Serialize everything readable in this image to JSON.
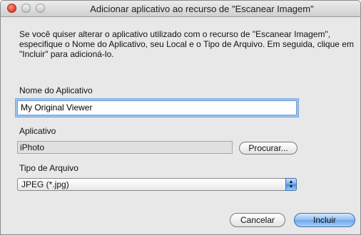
{
  "window": {
    "title": "Adicionar aplicativo ao recurso de \"Escanear Imagem\""
  },
  "description": "Se você quiser alterar o aplicativo utilizado com o recurso de \"Escanear Imagem\", especifique o Nome do Aplicativo, seu Local e o Tipo de Arquivo. Em seguida, clique em \"Incluir\" para adicioná-lo.",
  "app_name": {
    "label": "Nome do Aplicativo",
    "value": "My Original Viewer"
  },
  "application": {
    "label": "Aplicativo",
    "value": "iPhoto",
    "browse_label": "Procurar..."
  },
  "file_type": {
    "label": "Tipo de Arquivo",
    "selected": "JPEG (*.jpg)"
  },
  "buttons": {
    "cancel": "Cancelar",
    "include": "Incluir"
  },
  "icons": {
    "close": "close-icon",
    "minimize": "minimize-icon",
    "maximize": "zoom-icon",
    "popup_arrows": "up-down-arrows-icon"
  },
  "colors": {
    "window_bg": "#e8e8e8",
    "accent_blue": "#6aa6ea",
    "close_red": "#d9402e"
  }
}
